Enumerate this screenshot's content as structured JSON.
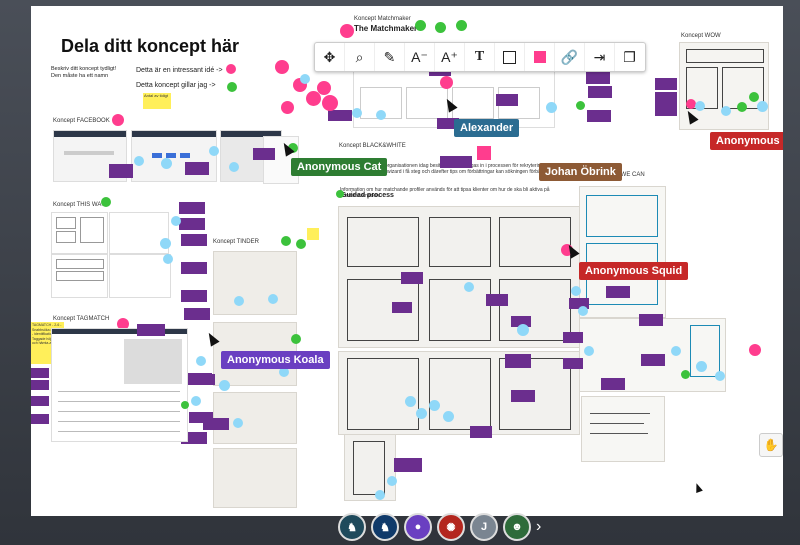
{
  "board": {
    "title": "Dela ditt koncept här",
    "instructions": [
      "Beskriv ditt koncept tydligt!",
      "Den måste ha ett namn"
    ],
    "hints": [
      "Detta är en intressant idé ->",
      "Detta koncept gillar jag ->"
    ],
    "yellow_note": "Antal av tidigt"
  },
  "sections": {
    "facebook": "Koncept FACEBOOK",
    "this_way": "Koncept THIS WAY",
    "tinder": "Koncept TINDER",
    "tagmatch": "Koncept TAGMATCH",
    "matchmaker_label": "Koncept Matchmaker",
    "matchmaker_title": "The Matchmaker",
    "black_white": "Koncept BLACK&WHITE",
    "black_white_desc": "som organisationen idag besitter måste byggas in i processen för rekryteringssökning. Mha tydlig wizard i få steg och därefter tips om förbättringar kan sökningen förbättras.",
    "guided_desc": "Information om hur matchande profiler används för att tipsa klienter om hur de ska bli aktiva på arbetsmarknaden.",
    "guided": "Guidad process",
    "wow": "Koncept WOW",
    "we_can": "ES WE CAN"
  },
  "yellow_side_note": "TAGMATCH - 2-6 - Snabbsöka operera - identifikation - Taggade höjdare och hämta-aktivitet",
  "users": [
    {
      "name": "Anonymous Cat",
      "color": "#2e7d32"
    },
    {
      "name": "Alexander",
      "color": "#2b6c91"
    },
    {
      "name": "Johan Öbrink",
      "color": "#8d5a35"
    },
    {
      "name": "Anonymous Duck",
      "color": "#c62828"
    },
    {
      "name": "Anonymous Squid",
      "color": "#c62828"
    },
    {
      "name": "Anonymous Koala",
      "color": "#6a3fc1"
    }
  ],
  "toolbar": {
    "tools": [
      "move-icon",
      "zoom-select-icon",
      "pen-icon",
      "text-smaller-icon",
      "text-larger-icon",
      "text-icon",
      "rectangle-icon",
      "color-swatch-icon",
      "link-icon",
      "arrange-icon",
      "group-icon"
    ],
    "font_down": "A⁻",
    "font_up": "A⁺",
    "swatch_color": "#ff3d8e"
  },
  "dock": {
    "avatars": [
      "seahorse",
      "seahorse-blue",
      "koala",
      "squid",
      "J",
      "cat"
    ],
    "initial": "J"
  }
}
